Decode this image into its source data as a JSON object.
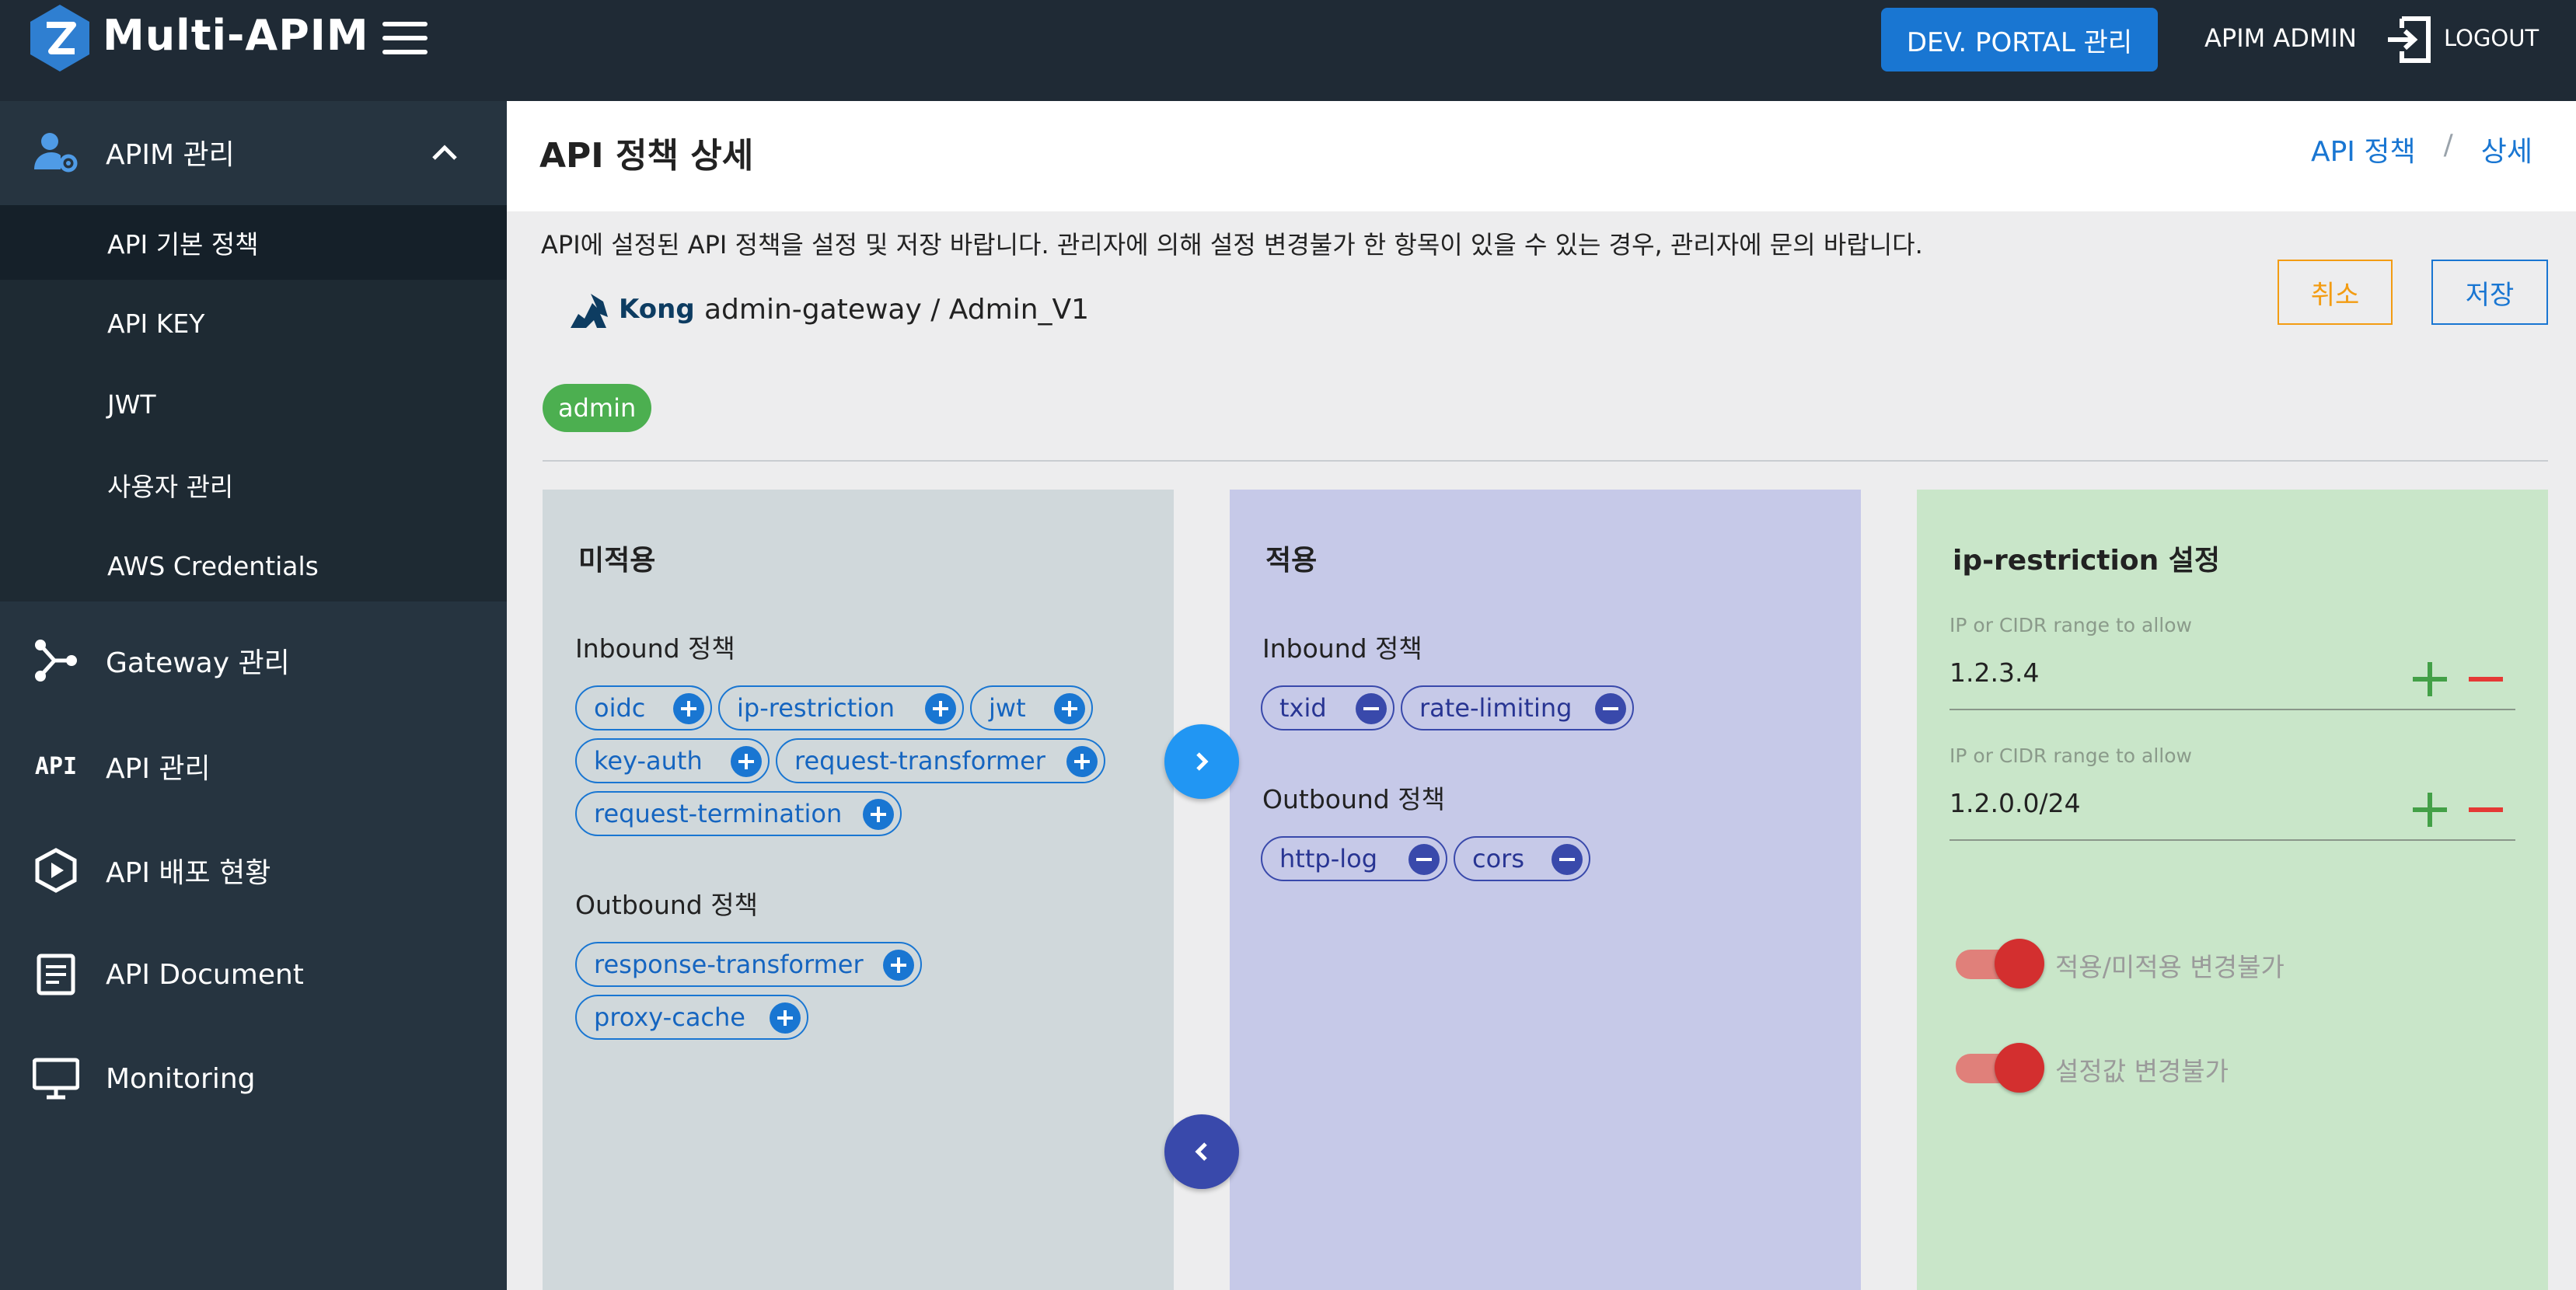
{
  "header": {
    "app_title": "Multi-APIM",
    "devportal_button": "DEV. PORTAL 관리",
    "admin_name": "APIM ADMIN",
    "logout_label": "LOGOUT"
  },
  "sidebar": {
    "apim": {
      "label": "APIM 관리",
      "icon": "user-gear-icon"
    },
    "submenu": [
      {
        "label": "API 기본 정책",
        "active": true
      },
      {
        "label": "API KEY"
      },
      {
        "label": "JWT"
      },
      {
        "label": "사용자 관리"
      },
      {
        "label": "AWS Credentials"
      }
    ],
    "items": [
      {
        "label": "Gateway 관리",
        "icon": "gateway-icon"
      },
      {
        "label": "API 관리",
        "icon": "api-icon",
        "icon_text": "API"
      },
      {
        "label": "API 배포 현황",
        "icon": "deploy-icon"
      },
      {
        "label": "API Document",
        "icon": "document-icon"
      },
      {
        "label": "Monitoring",
        "icon": "monitor-icon"
      }
    ]
  },
  "page": {
    "title": "API 정책 상세",
    "breadcrumb": [
      "API 정책",
      "상세"
    ],
    "breadcrumb_sep": "/",
    "description": "API에 설정된 API 정책을 설정 및 저장 바랍니다. 관리자에 의해 설정 변경불가 한 항목이 있을 수 있는 경우, 관리자에 문의 바랍니다.",
    "cancel_label": "취소",
    "save_label": "저장",
    "gateway_brand": "Kong",
    "gateway_name": "admin-gateway / Admin_V1",
    "badge": "admin"
  },
  "unapplied": {
    "title": "미적용",
    "inbound_title": "Inbound 정책",
    "inbound": [
      "oidc",
      "ip-restriction",
      "jwt",
      "key-auth",
      "request-transformer",
      "request-termination"
    ],
    "outbound_title": "Outbound 정책",
    "outbound": [
      "response-transformer",
      "proxy-cache"
    ]
  },
  "applied": {
    "title": "적용",
    "inbound_title": "Inbound 정책",
    "inbound": [
      "txid",
      "rate-limiting"
    ],
    "outbound_title": "Outbound 정책",
    "outbound": [
      "http-log",
      "cors"
    ]
  },
  "settings": {
    "title": "ip-restriction 설정",
    "fields": [
      {
        "label": "IP or CIDR range to allow",
        "value": "1.2.3.4"
      },
      {
        "label": "IP or CIDR range to allow",
        "value": "1.2.0.0/24"
      }
    ],
    "toggles": [
      {
        "label": "적용/미적용 변경불가",
        "on": true
      },
      {
        "label": "설정값 변경불가",
        "on": true
      }
    ]
  },
  "colors": {
    "topbar": "#1f2a35",
    "accent": "#1976d2",
    "badge": "#4caf50",
    "cancel": "#f39c12",
    "danger": "#d32f2f"
  }
}
